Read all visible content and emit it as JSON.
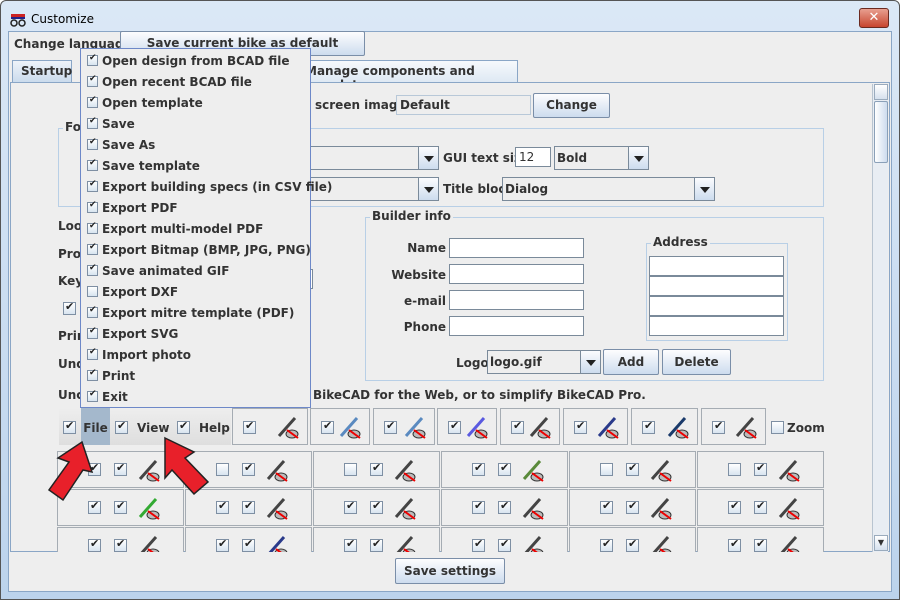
{
  "window": {
    "title": "Customize"
  },
  "top": {
    "change_language": "Change language",
    "save_default": "Save current bike as default template"
  },
  "tabs": [
    {
      "label": "Startup",
      "selected": true
    },
    {
      "label": "Manage components and templates",
      "selected": false
    }
  ],
  "startup": {
    "screen_image_label": "screen image",
    "screen_image_value": "Default",
    "change_button": "Change",
    "fonts_group": "Fo",
    "gui_text_size_label": "GUI text size",
    "gui_text_size_value": "12",
    "gui_style_value": "Bold",
    "title_block_label": "Title block",
    "title_block_value": "Dialog",
    "left_labels": [
      "Loo",
      "Prog",
      "Key",
      "Prin",
      "Und",
      "Unc"
    ],
    "left_checkbox": true,
    "builder_info": {
      "title": "Builder info",
      "name_label": "Name",
      "website_label": "Website",
      "email_label": "e-mail",
      "phone_label": "Phone",
      "name": "",
      "website": "",
      "email": "",
      "phone": "",
      "address_title": "Address",
      "address": [
        "",
        "",
        "",
        ""
      ],
      "logo_label": "Logo",
      "logo_value": "logo.gif",
      "add_button": "Add",
      "delete_button": "Delete"
    },
    "note": "BikeCAD for the Web, or to simplify BikeCAD Pro."
  },
  "menubar_row": {
    "file": {
      "label": "File",
      "checked": true
    },
    "view": {
      "label": "View",
      "checked": true
    },
    "help": {
      "label": "Help",
      "checked": true
    },
    "tools": [
      {
        "icon": "model-one-icon",
        "checked": true
      },
      {
        "icon": "undo-icon",
        "checked": true
      },
      {
        "icon": "redo-icon",
        "checked": true
      },
      {
        "icon": "terrain-icon",
        "checked": true
      },
      {
        "icon": "wheel-arrow-icon",
        "checked": true
      },
      {
        "icon": "frame-icon",
        "checked": true
      },
      {
        "icon": "frame-lock-icon",
        "checked": true
      },
      {
        "icon": "layers-lock-icon",
        "checked": true
      }
    ],
    "zoom": {
      "label": "Zoom",
      "checked": false
    }
  },
  "grid": [
    [
      {
        "a": true,
        "b": true,
        "icon": "helmet-icon"
      },
      {
        "a": false,
        "b": true,
        "icon": "crosshair-icon"
      },
      {
        "a": false,
        "b": true,
        "icon": "saddle-shape-icon"
      },
      {
        "a": true,
        "b": true,
        "icon": "rider-photo-icon"
      },
      {
        "a": false,
        "b": true,
        "icon": "crank-icon"
      },
      {
        "a": false,
        "b": true,
        "icon": "fork-icon"
      }
    ],
    [
      {
        "a": true,
        "b": true,
        "icon": "color-tube-icon"
      },
      {
        "a": true,
        "b": true,
        "icon": "tube-icon"
      },
      {
        "a": true,
        "b": true,
        "icon": "window-icon"
      },
      {
        "a": true,
        "b": true,
        "icon": "centerline-icon"
      },
      {
        "a": true,
        "b": true,
        "icon": "dimension-icon"
      },
      {
        "a": true,
        "b": true,
        "icon": "note-icon"
      }
    ],
    [
      {
        "a": true,
        "b": true,
        "icon": "rider-icon"
      },
      {
        "a": true,
        "b": true,
        "icon": "frame-icon"
      },
      {
        "a": true,
        "b": true,
        "icon": "decal-icon"
      },
      {
        "a": true,
        "b": true,
        "icon": "saddle-icon"
      },
      {
        "a": true,
        "b": true,
        "icon": "seatpost-icon"
      },
      {
        "a": true,
        "b": true,
        "icon": "handlebar-icon"
      }
    ]
  ],
  "file_menu": [
    {
      "label": "Open design from BCAD file",
      "checked": true
    },
    {
      "label": "Open recent BCAD file",
      "checked": true
    },
    {
      "label": "Open template",
      "checked": true
    },
    {
      "label": "Save",
      "checked": true
    },
    {
      "label": "Save As",
      "checked": true
    },
    {
      "label": "Save template",
      "checked": true
    },
    {
      "label": "Export building specs (in CSV file)",
      "checked": true
    },
    {
      "label": "Export PDF",
      "checked": true
    },
    {
      "label": "Export multi-model PDF",
      "checked": true
    },
    {
      "label": "Export Bitmap (BMP, JPG, PNG)",
      "checked": true
    },
    {
      "label": "Save animated GIF",
      "checked": true
    },
    {
      "label": "Export DXF",
      "checked": false
    },
    {
      "label": "Export mitre template (PDF)",
      "checked": true
    },
    {
      "label": "Export SVG",
      "checked": true
    },
    {
      "label": "Import photo",
      "checked": true
    },
    {
      "label": "Print",
      "checked": true
    },
    {
      "label": "Exit",
      "checked": true
    }
  ],
  "footer": {
    "save_settings": "Save settings"
  },
  "colors": {
    "accent": "#a4b8cc",
    "arrow": "#e8202a"
  }
}
